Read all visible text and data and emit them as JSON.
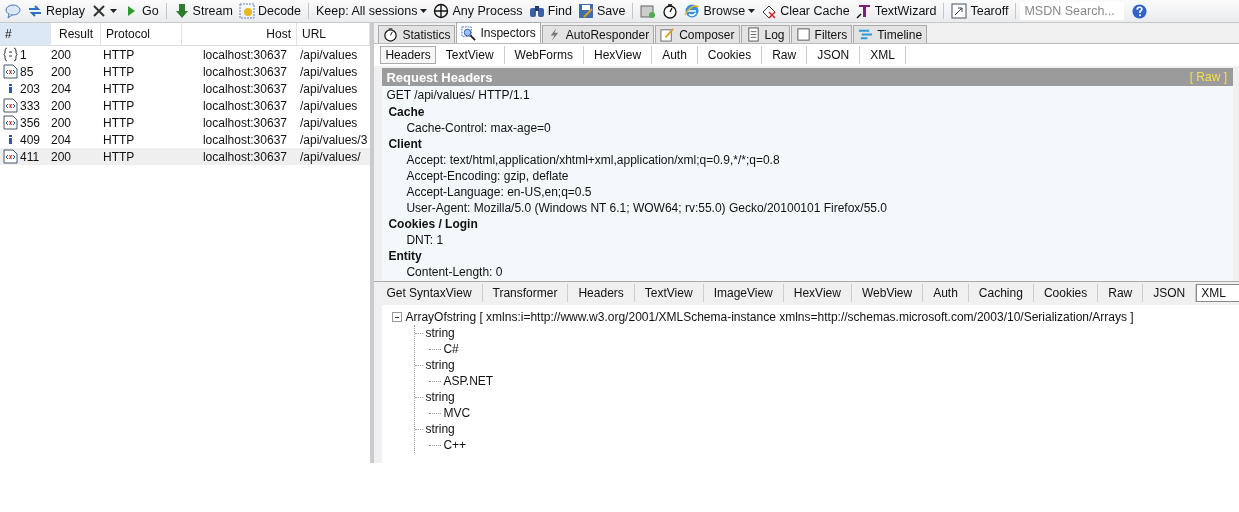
{
  "toolbar": {
    "groups": [
      [
        {
          "dropdown": false
        },
        {
          "label": "Replay",
          "dropdown": false
        },
        {
          "dropdown": true
        },
        {
          "label": "Go",
          "dropdown": false
        }
      ],
      [
        {
          "label": "Stream",
          "dropdown": false
        },
        {
          "label": "Decode",
          "dropdown": false
        }
      ],
      [
        {
          "label": "Keep: All sessions",
          "dropdown": true
        },
        {
          "label": "Any Process",
          "dropdown": false
        },
        {
          "label": "Find",
          "dropdown": false
        },
        {
          "label": "Save",
          "dropdown": false
        }
      ],
      [
        {
          "dropdown": false
        },
        {
          "dropdown": false
        },
        {
          "label": "Browse",
          "dropdown": true
        },
        {
          "label": "Clear Cache",
          "dropdown": false
        },
        {
          "label": "TextWizard",
          "dropdown": false
        }
      ],
      [
        {
          "label": "Tearoff",
          "dropdown": false
        }
      ]
    ],
    "search": {
      "placeholder": "MSDN Search..."
    }
  },
  "sessions": {
    "columns": [
      "#",
      "Result",
      "Protocol",
      "Host",
      "URL"
    ],
    "rows": [
      {
        "kind": "json",
        "id": "1",
        "result": "200",
        "protocol": "HTTP",
        "host": "localhost:30637",
        "url": "/api/values",
        "selected": false
      },
      {
        "kind": "xml",
        "id": "85",
        "result": "200",
        "protocol": "HTTP",
        "host": "localhost:30637",
        "url": "/api/values",
        "selected": false
      },
      {
        "kind": "info",
        "id": "203",
        "result": "204",
        "protocol": "HTTP",
        "host": "localhost:30637",
        "url": "/api/values",
        "selected": false
      },
      {
        "kind": "xml",
        "id": "333",
        "result": "200",
        "protocol": "HTTP",
        "host": "localhost:30637",
        "url": "/api/values",
        "selected": false
      },
      {
        "kind": "xml",
        "id": "356",
        "result": "200",
        "protocol": "HTTP",
        "host": "localhost:30637",
        "url": "/api/values",
        "selected": false
      },
      {
        "kind": "info",
        "id": "409",
        "result": "204",
        "protocol": "HTTP",
        "host": "localhost:30637",
        "url": "/api/values/3",
        "selected": false
      },
      {
        "kind": "xml",
        "id": "411",
        "result": "200",
        "protocol": "HTTP",
        "host": "localhost:30637",
        "url": "/api/values/",
        "selected": true
      }
    ]
  },
  "main_tabs": [
    {
      "label": "Statistics",
      "selected": false
    },
    {
      "label": "Inspectors",
      "selected": true
    },
    {
      "label": "AutoResponder",
      "selected": false
    },
    {
      "label": "Composer",
      "selected": false
    },
    {
      "label": "Log",
      "selected": false
    },
    {
      "label": "Filters",
      "selected": false
    },
    {
      "label": "Timeline",
      "selected": false
    }
  ],
  "request_tabs": [
    {
      "label": "Headers",
      "selected": true
    },
    {
      "label": "TextView",
      "selected": false
    },
    {
      "label": "WebForms",
      "selected": false
    },
    {
      "label": "HexView",
      "selected": false
    },
    {
      "label": "Auth",
      "selected": false
    },
    {
      "label": "Cookies",
      "selected": false
    },
    {
      "label": "Raw",
      "selected": false
    },
    {
      "label": "JSON",
      "selected": false
    },
    {
      "label": "XML",
      "selected": false
    }
  ],
  "request_headers": {
    "title": "Request Headers",
    "raw_link": "[ Raw ]",
    "request_line": "GET /api/values/ HTTP/1.1",
    "groups": [
      {
        "name": "Cache",
        "lines": [
          "Cache-Control: max-age=0"
        ]
      },
      {
        "name": "Client",
        "lines": [
          "Accept: text/html,application/xhtml+xml,application/xml;q=0.9,*/*;q=0.8",
          "Accept-Encoding: gzip, deflate",
          "Accept-Language: en-US,en;q=0.5",
          "User-Agent: Mozilla/5.0 (Windows NT 6.1; WOW64; rv:55.0) Gecko/20100101 Firefox/55.0"
        ]
      },
      {
        "name": "Cookies / Login",
        "lines": [
          "DNT: 1"
        ]
      },
      {
        "name": "Entity",
        "lines": [
          "Content-Length: 0"
        ]
      }
    ]
  },
  "response_tabs": [
    {
      "label": "Get SyntaxView",
      "selected": false
    },
    {
      "label": "Transformer",
      "selected": false
    },
    {
      "label": "Headers",
      "selected": false
    },
    {
      "label": "TextView",
      "selected": false
    },
    {
      "label": "ImageView",
      "selected": false
    },
    {
      "label": "HexView",
      "selected": false
    },
    {
      "label": "WebView",
      "selected": false
    },
    {
      "label": "Auth",
      "selected": false
    },
    {
      "label": "Caching",
      "selected": false
    },
    {
      "label": "Cookies",
      "selected": false
    },
    {
      "label": "Raw",
      "selected": false
    },
    {
      "label": "JSON",
      "selected": false
    },
    {
      "label": "XML",
      "selected": true
    }
  ],
  "xml_tree": {
    "label": "ArrayOfstring [ xmlns:i=http://www.w3.org/2001/XMLSchema-instance xmlns=http://schemas.microsoft.com/2003/10/Serialization/Arrays ]",
    "expanded": true,
    "children": [
      {
        "label": "string",
        "children": [
          {
            "label": "C#"
          }
        ]
      },
      {
        "label": "string",
        "children": [
          {
            "label": "ASP.NET"
          }
        ]
      },
      {
        "label": "string",
        "children": [
          {
            "label": "MVC"
          }
        ]
      },
      {
        "label": "string",
        "children": [
          {
            "label": "C++"
          }
        ]
      }
    ]
  }
}
